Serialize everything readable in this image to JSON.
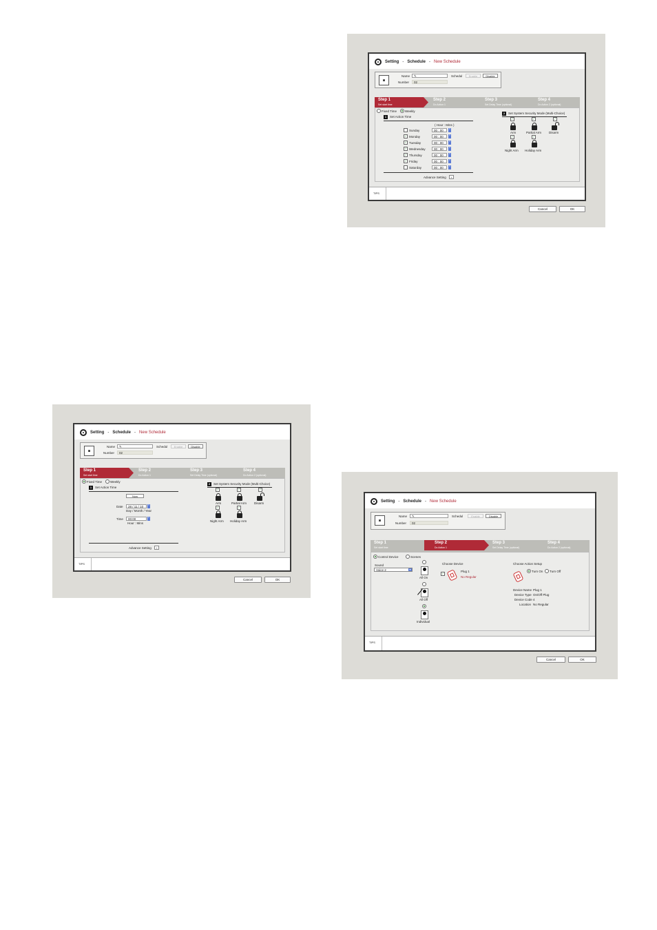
{
  "common": {
    "nav_setting": "Setting",
    "nav_schedule": "Schedule",
    "nav_new": "New Schedule",
    "sep": "-",
    "name_label": "Name",
    "number_label": "Number",
    "number_value": "02",
    "schedul_label": "Schedul",
    "enable_label": "Enable",
    "disable_label": "Disable",
    "tips_label": "TIPS",
    "cancel_label": "Cancel",
    "ok_label": "OK",
    "step1_title": "Step 1",
    "step1_sub": "Set start time",
    "step2_title": "Step 2",
    "step2_sub": "Do Action 1",
    "step3_title": "Step 3",
    "step3_sub": "Set Delay Time (optional)",
    "step4_title": "Step 4",
    "step4_sub": "Do Action 2 (optional)",
    "fixed_time": "Fixed Time",
    "weekly": "Weekly",
    "set_action_time": "Set Action Time",
    "set_security_mode": "Set System Security Mode (Multi-Choice)",
    "advance_setting": "Advance Setting",
    "modes": [
      "Arm",
      "Partial Arm",
      "Disarm",
      "Night Arm",
      "Holiday Arm"
    ]
  },
  "weekly_screen": {
    "hour_min_header": "( Hour : Mins )",
    "days": [
      {
        "label": "Sunday",
        "checked": false,
        "time": "00 : 00"
      },
      {
        "label": "Monday",
        "checked": true,
        "time": "00 : 00"
      },
      {
        "label": "Tuesday",
        "checked": true,
        "time": "00 : 00"
      },
      {
        "label": "Wednesday",
        "checked": true,
        "time": "00 : 00"
      },
      {
        "label": "Thursday",
        "checked": true,
        "time": "00 : 00"
      },
      {
        "label": "Friday",
        "checked": true,
        "time": "00 : 00"
      },
      {
        "label": "Saturday",
        "checked": false,
        "time": "00 : 00"
      }
    ]
  },
  "fixed_screen": {
    "now_button": "Now",
    "date_label": "Date",
    "date_value": "28 / 11 / 10",
    "date_hint": "Day / Month / Year",
    "time_label": "Time",
    "time_value": "00:00",
    "time_hint": "Hour : Mins"
  },
  "action_screen": {
    "control_device": "Control Device",
    "scenes": "Scenes",
    "sound_label": "Sound",
    "sound_value": "Voice 2",
    "all_on": "All On",
    "all_off": "All Off",
    "individual": "Individual",
    "choose_device": "Choose Device",
    "plug_name": "Plug 1",
    "no_regular": "No Regular",
    "choose_action": "Choose Action Setup",
    "turn_on": "Turn On",
    "turn_off": "Turn Off",
    "device_name_label": "Device Name",
    "device_name_value": "Plug 1",
    "device_type_label": "Device Type",
    "device_type_value": "On/Off Plug",
    "device_code_label": "Device Code",
    "device_code_value": "4",
    "location_label": "Location",
    "location_value": "No Regular"
  }
}
